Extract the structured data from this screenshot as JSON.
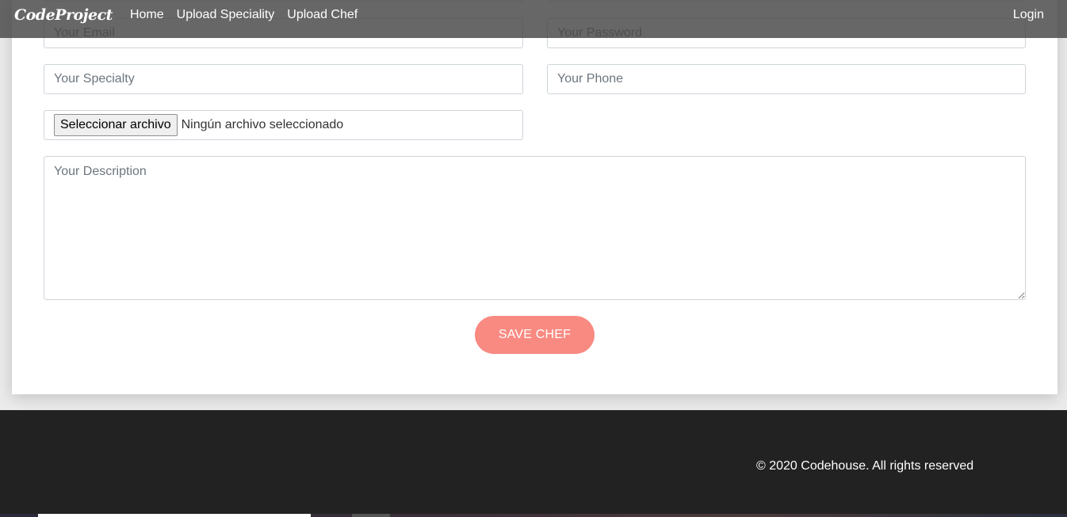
{
  "navbar": {
    "brand": "CodeProject",
    "links": [
      "Home",
      "Upload Speciality",
      "Upload Chef"
    ],
    "login": "Login"
  },
  "form": {
    "email_placeholder": "Your Email",
    "password_placeholder": "Your Password",
    "specialty_placeholder": "Your Specialty",
    "phone_placeholder": "Your Phone",
    "file_button": "Seleccionar archivo",
    "file_status": "Ningún archivo seleccionado",
    "description_placeholder": "Your Description",
    "save_label": "SAVE CHEF"
  },
  "footer": {
    "copyright": "© 2020 Codehouse. All rights reserved"
  },
  "colors": {
    "accent": "#f98a82",
    "navbar": "#464646",
    "footer": "#222222"
  }
}
